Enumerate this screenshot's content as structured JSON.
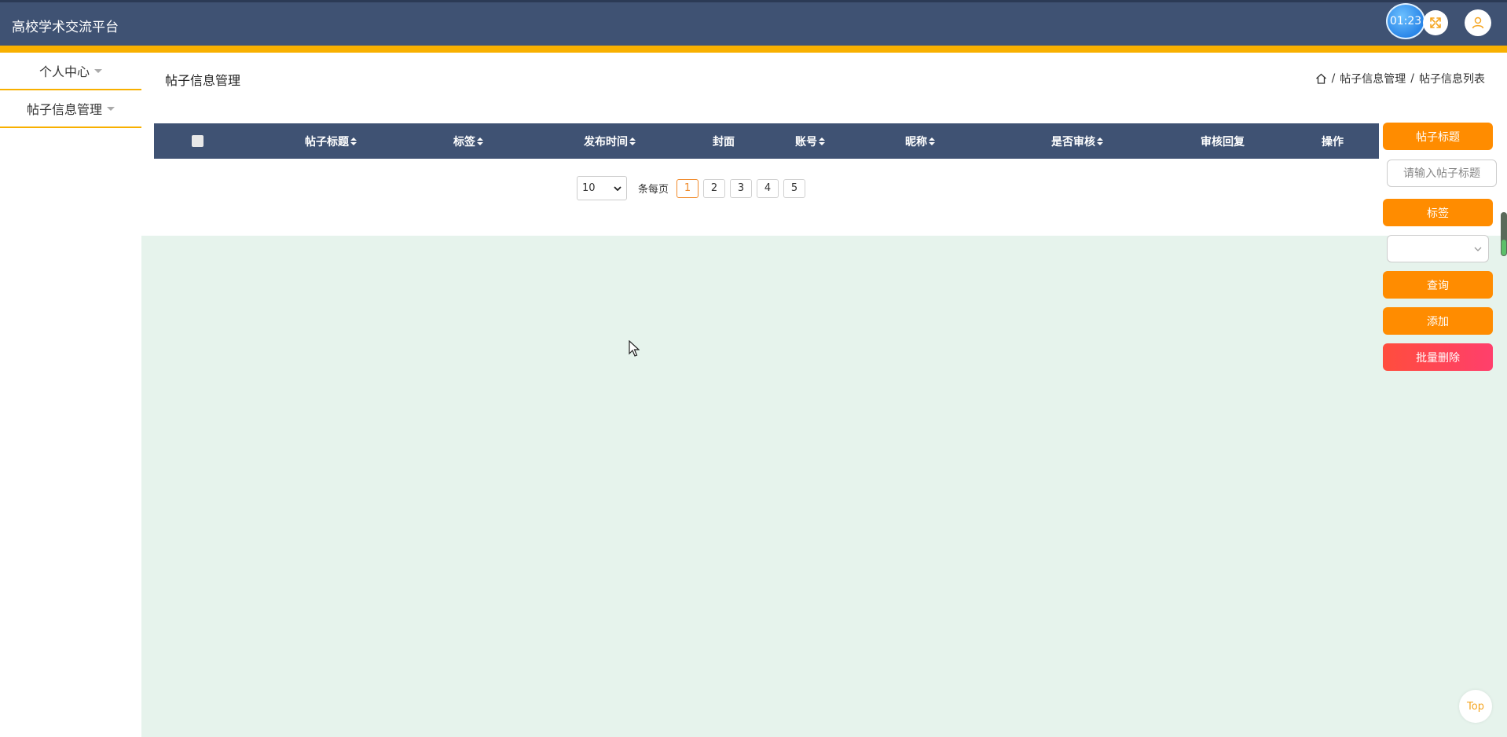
{
  "header": {
    "title": "高校学术交流平台",
    "timer": "01:23",
    "fullscreen_icon": "expand-icon",
    "user_icon": "user-icon"
  },
  "colors": {
    "header_bg": "#3f5273",
    "accent_strip": "#f8b000",
    "button_orange": "#ff8c00",
    "button_red": "#ff4d3d",
    "content_bg": "#e6f3ec"
  },
  "sidebar": {
    "items": [
      {
        "label": "个人中心"
      },
      {
        "label": "帖子信息管理"
      }
    ]
  },
  "page": {
    "title": "帖子信息管理",
    "breadcrumb": [
      "帖子信息管理",
      "帖子信息列表"
    ],
    "breadcrumb_sep": "/"
  },
  "table": {
    "columns": [
      "帖子标题",
      "标签",
      "发布时间",
      "封面",
      "账号",
      "昵称",
      "是否审核",
      "审核回复",
      "操作"
    ],
    "rows": []
  },
  "pagination": {
    "page_size": "10",
    "per_page_label": "条每页",
    "pages": [
      "1",
      "2",
      "3",
      "4",
      "5"
    ],
    "current": "1"
  },
  "filters": {
    "title_label": "帖子标题",
    "title_placeholder": "请输入帖子标题",
    "tag_label": "标签",
    "tag_value": ""
  },
  "actions": {
    "search": "查询",
    "add": "添加",
    "batch_delete": "批量删除"
  },
  "back_to_top": "Top"
}
